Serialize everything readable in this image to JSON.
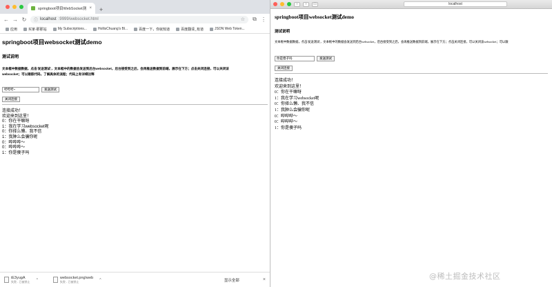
{
  "left_window": {
    "tab_title": "springboot项目WebSocket测试",
    "url_prefix": "localhost",
    "url_rest": ":9999/websocket.html",
    "bookmarks": [
      "应用",
      "买家-那那站",
      "My Subscriptions...",
      "HollisChuang's Bl...",
      "百度一下，你就知道",
      "百度翻译_有道",
      "JSON Web Token..."
    ],
    "page": {
      "title": "springboot项目websocket测试demo",
      "section": "测试说明",
      "description_line1": "文本框中数据数据，点击'发送测试'，文本框中的数据会发送到后台websocket，后台接受到之后，会再推送数据到前端，展示在下方；点击关闭连接，可以关闭该",
      "description_line2": "websocket；可以跟踪代码，了解具体的流程；代码上有详细注释",
      "input_value": "哔哔哔~",
      "send_button": "发送测试",
      "close_button": "关闭连接",
      "messages": [
        "连接成功！",
        "欢迎来到这里！",
        "0：你在干嘛呀",
        "1：我在学习websocket呢",
        "0：你择么懒、我不信",
        "1：我肿么会骗你呢",
        "0：哔哔哔～",
        "0：哔哔哔～",
        "1：你是傻子吗"
      ]
    },
    "downloads": [
      {
        "name": "iE3yugA",
        "status": "失败 - 已被禁止"
      },
      {
        "name": "websocket.png\\web",
        "status": "失败 - 已被禁止"
      }
    ],
    "show_all": "显示全部"
  },
  "right_window": {
    "address": "localhost",
    "page": {
      "title": "springboot项目websocket测试demo",
      "section": "测试说明",
      "description": "文本框中数据数据，点击'发送测试'，文本框中的数据会发送到后台websocket，后台接受到之后，会再推送数据到前端，展示在下方；点击关闭连接，可以关闭该websocket；可以跟",
      "input_value": "你是傻子吗",
      "send_button": "发送测试",
      "close_button": "关闭连接",
      "messages": [
        "连接成功！",
        "欢迎来到这里！",
        "0：你在干嘛呀",
        "1：我在学习websocket呢",
        "0：你择么懒、我不信",
        "1：我肿么会骗你呢",
        "0：哔哔哔～",
        "0：哔哔哔～",
        "1：你是傻子吗"
      ]
    }
  },
  "watermark": "@稀土掘金技术社区"
}
